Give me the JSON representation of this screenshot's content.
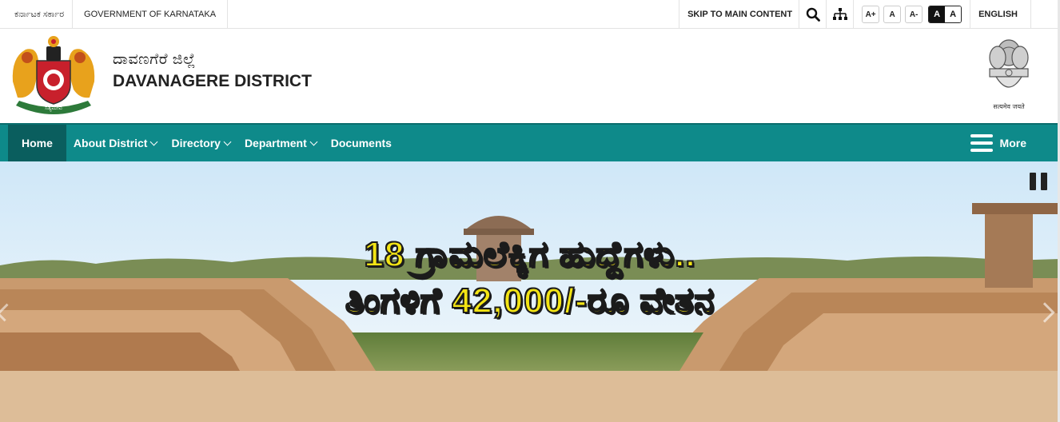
{
  "topbar": {
    "govt_kannada": "ಕರ್ನಾಟಕ ಸರ್ಕಾರ",
    "govt_english": "GOVERNMENT OF KARNATAKA",
    "skip_label": "SKIP TO MAIN CONTENT",
    "search_icon": "search-icon",
    "sitemap_icon": "sitemap-icon",
    "font_increase": "A+",
    "font_normal": "A",
    "font_decrease": "A-",
    "contrast_dark": "A",
    "contrast_light": "A",
    "language": "ENGLISH"
  },
  "header": {
    "title_kannada": "ದಾವಣಗೆರೆ ಜಿಲ್ಲೆ",
    "title_english": "DAVANAGERE DISTRICT",
    "emblem_motto": "सत्यमेव जयते"
  },
  "nav": {
    "items": [
      {
        "label": "Home",
        "active": true,
        "dropdown": false
      },
      {
        "label": "About District",
        "active": false,
        "dropdown": true
      },
      {
        "label": "Directory",
        "active": false,
        "dropdown": true
      },
      {
        "label": "Department",
        "active": false,
        "dropdown": true
      },
      {
        "label": "Documents",
        "active": false,
        "dropdown": false
      }
    ],
    "more_label": "More"
  },
  "slider": {
    "line1": "18 ಗ್ರಾಮಲೆಕ್ಕಿಗ ಹುದ್ದೆಗಳು..",
    "line2": "ತಿಂಗಳಿಗೆ 42,000/-ರೂ ವೇತನ"
  },
  "colors": {
    "nav_bg": "#0e8a8a",
    "nav_active": "#0a5e5e",
    "slide_text": "#f3e414",
    "below_bg": "#ddbd98"
  }
}
